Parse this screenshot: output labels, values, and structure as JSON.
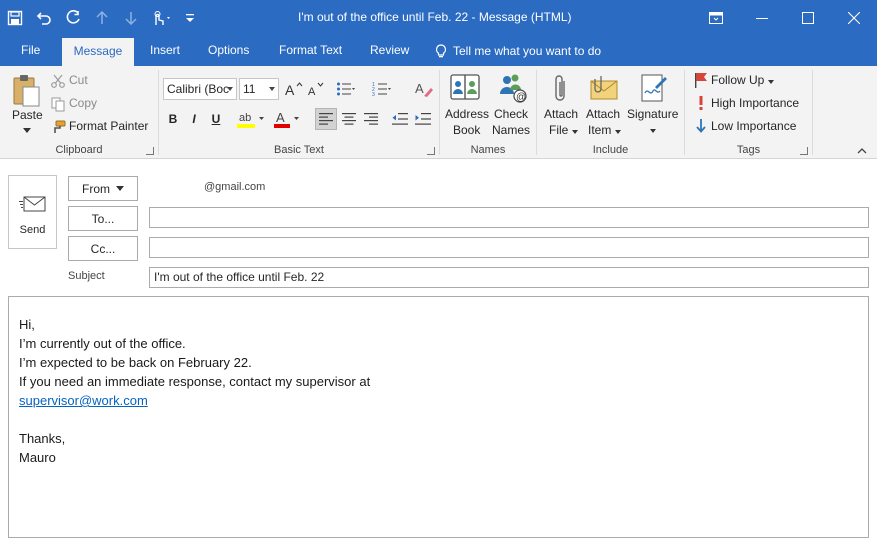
{
  "window": {
    "title": "I'm out of the office until Feb. 22  -  Message (HTML)"
  },
  "quick_access": {
    "icons": [
      "save-icon",
      "undo-icon",
      "redo-icon",
      "up-arrow-icon",
      "down-arrow-icon",
      "touch-mode-icon",
      "customize-qat-icon"
    ]
  },
  "tabs": [
    {
      "label": "File"
    },
    {
      "label": "Message"
    },
    {
      "label": "Insert"
    },
    {
      "label": "Options"
    },
    {
      "label": "Format Text"
    },
    {
      "label": "Review"
    }
  ],
  "tell_me": "Tell me what you want to do",
  "ribbon": {
    "clipboard": {
      "label": "Clipboard",
      "paste": "Paste",
      "cut": "Cut",
      "copy": "Copy",
      "format_painter": "Format Painter"
    },
    "basic_text": {
      "label": "Basic Text",
      "font": "Calibri (Boc",
      "size": "11",
      "bold": "B",
      "italic": "I",
      "underline": "U"
    },
    "names": {
      "label": "Names",
      "address_book_1": "Address",
      "address_book_2": "Book",
      "check_names_1": "Check",
      "check_names_2": "Names"
    },
    "include": {
      "label": "Include",
      "attach_file_1": "Attach",
      "attach_file_2": "File",
      "attach_item_1": "Attach",
      "attach_item_2": "Item",
      "signature": "Signature"
    },
    "tags": {
      "label": "Tags",
      "follow_up": "Follow Up",
      "high": "High Importance",
      "low": "Low Importance"
    }
  },
  "compose": {
    "send": "Send",
    "from_label": "From",
    "from_value": "@gmail.com",
    "to_label": "To...",
    "cc_label": "Cc...",
    "to_value": "",
    "cc_value": "",
    "subject_label": "Subject",
    "subject_value": "I'm out of the office until Feb. 22"
  },
  "body": {
    "line1": "Hi,",
    "line2": "I’m currently out of the office.",
    "line3": "I’m expected to be back on February 22.",
    "line4": "If you need an immediate response, contact my supervisor at",
    "link": "supervisor@work.com",
    "line6": "Thanks,",
    "line7": "Mauro"
  },
  "colors": {
    "accent": "#2b6bc1",
    "ribbon_bg": "#f3f3f3",
    "link": "#0563c1"
  }
}
